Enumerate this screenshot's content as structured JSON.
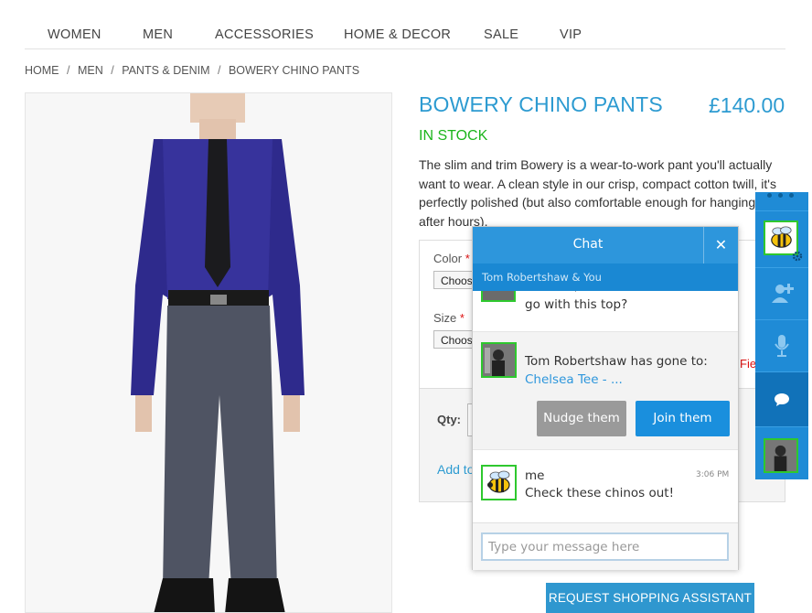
{
  "nav": {
    "items": [
      "WOMEN",
      "MEN",
      "ACCESSORIES",
      "HOME & DECOR",
      "SALE",
      "VIP"
    ]
  },
  "breadcrumb": [
    "HOME",
    "MEN",
    "PANTS & DENIM",
    "BOWERY CHINO PANTS"
  ],
  "breadcrumb_separator": "/",
  "product": {
    "title": "BOWERY CHINO PANTS",
    "price": "£140.00",
    "stock": "IN STOCK",
    "description": "The slim and trim Bowery is a wear-to-work pant you'll actually want to wear. A clean style in our crisp, compact cotton twill, it's perfectly polished (but also comfortable enough for hanging after hours).",
    "color_label": "Color",
    "size_label": "Size",
    "required_mark": "*",
    "color_select": "Choose",
    "size_select": "Choose",
    "qty_label": "Qty:",
    "add_to_cart": "Add to",
    "field_note": "Fie"
  },
  "shopping_assistant_button": "REQUEST SHOPPING ASSISTANT",
  "chat": {
    "title": "Chat",
    "close_glyph": "✕",
    "participants": "Tom Robertshaw & You",
    "partial_message": "Hi there, what trousers would go with this top?",
    "system_name": "Tom Robertshaw",
    "system_text": "has gone to:",
    "system_link": "Chelsea Tee - ...",
    "nudge_button": "Nudge them",
    "join_button": "Join them",
    "me_name": "me",
    "me_time": "3:06 PM",
    "me_message": "Check these chinos out!",
    "input_placeholder": "Type your message here"
  },
  "sidebar": {
    "icons": [
      "bee-avatar-icon",
      "settings-gear-icon",
      "add-user-icon",
      "microphone-icon",
      "chat-bubble-icon",
      "user-photo-avatar"
    ]
  },
  "colors": {
    "accent_blue": "#2d9bd1",
    "in_stock_green": "#1cb51c",
    "chat_header": "#2d96dc",
    "avatar_border": "#2ec82e"
  }
}
